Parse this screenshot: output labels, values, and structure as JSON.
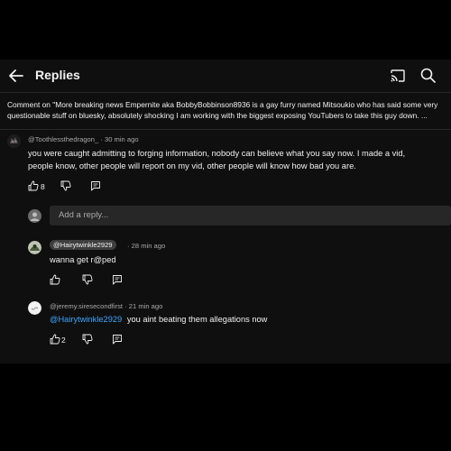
{
  "header": {
    "title": "Replies",
    "back_icon": "back-arrow-icon",
    "cast_icon": "cast-icon",
    "search_icon": "search-icon"
  },
  "context": {
    "line1": "Comment on \"More breaking news Empernite aka BobbyBobbinson8936 is a gay furry named Mitsoukio who has said some very",
    "line2": "questionable stuff on bluesky, absolutely shocking I am working with the biggest exposing YouTubers to take this guy down. ..."
  },
  "main_comment": {
    "handle": "@Toothlessthedragon_",
    "time": "· 30 min ago",
    "line1": "you were caught admitting to forging information, nobody can believe what you say now. I made a vid,",
    "line2": "people know, other people will report on my vid, other people will know how bad you are.",
    "like_count": "8"
  },
  "reply_input": {
    "placeholder": "Add a reply..."
  },
  "replies": [
    {
      "handle": "@Hairytwinkle2929",
      "time": "· 28 min ago",
      "text": "wanna get r@ped"
    },
    {
      "handle": "@jeremy.siresecondfirst",
      "time": "· 21 min ago",
      "mention": "@Hairytwinkle2929",
      "text": "you aint beating them allegations now",
      "like_count": "2"
    }
  ],
  "colors": {
    "background": "#0f0f0f",
    "text": "#f1f1f1",
    "secondary_text": "#aaaaaa",
    "link": "#3ea6ff",
    "input_bg": "#272727"
  }
}
